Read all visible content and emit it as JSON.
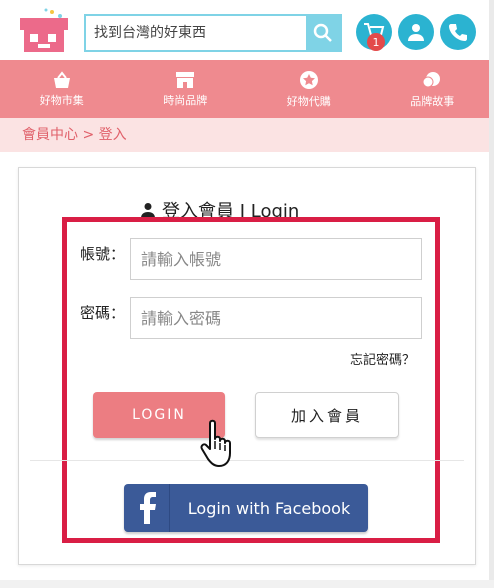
{
  "search": {
    "placeholder": "找到台灣的好東西"
  },
  "cart": {
    "count": "1"
  },
  "nav": [
    {
      "label": "好物市集",
      "icon": "basket-icon"
    },
    {
      "label": "時尚品牌",
      "icon": "storefront-icon"
    },
    {
      "label": "好物代購",
      "icon": "star-circle-icon"
    },
    {
      "label": "品牌故事",
      "icon": "chat-bubble-icon"
    }
  ],
  "breadcrumb": "會員中心 > 登入",
  "login": {
    "title": "登入會員 I Login",
    "account_label": "帳號：",
    "account_placeholder": "請輸入帳號",
    "password_label": "密碼：",
    "password_placeholder": "請輸入密碼",
    "forgot": "忘記密碼？",
    "login_button": "LOGIN",
    "join_button": "加入會員",
    "facebook_button": "Login with Facebook"
  },
  "colors": {
    "brand_pink": "#ef8a8f",
    "accent_blue": "#2bb3d1",
    "highlight_red": "#d91e45",
    "facebook_blue": "#3b5a98"
  }
}
